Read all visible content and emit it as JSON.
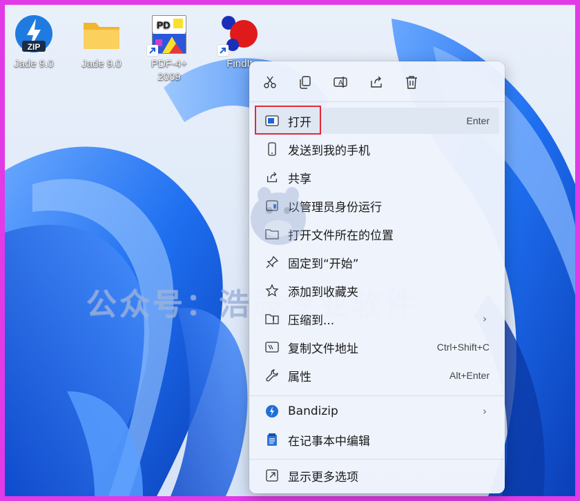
{
  "desktop": {
    "icons": [
      {
        "label": "Jade 9.0",
        "icon": "zip-archive-icon"
      },
      {
        "label": "Jade 9.0",
        "icon": "folder-icon"
      },
      {
        "label": "PDF-4+\n2009",
        "icon": "pdf-app-icon"
      },
      {
        "label": "FindIt",
        "icon": "findit-app-icon"
      }
    ],
    "watermark": "公众号：浩辰专业软件"
  },
  "context_menu": {
    "toolbar": [
      {
        "name": "cut",
        "icon": "scissors-icon"
      },
      {
        "name": "copy",
        "icon": "copy-icon"
      },
      {
        "name": "rename",
        "icon": "rename-icon"
      },
      {
        "name": "share",
        "icon": "share-icon"
      },
      {
        "name": "delete",
        "icon": "trash-icon"
      }
    ],
    "items": [
      {
        "label": "打开",
        "shortcut": "Enter",
        "icon": "open-window-icon"
      },
      {
        "label": "发送到我的手机",
        "shortcut": "",
        "icon": "phone-icon"
      },
      {
        "label": "共享",
        "shortcut": "",
        "icon": "share-icon"
      },
      {
        "label": "以管理员身份运行",
        "shortcut": "",
        "icon": "shield-icon"
      },
      {
        "label": "打开文件所在的位置",
        "shortcut": "",
        "icon": "folder-icon"
      },
      {
        "label": "固定到“开始”",
        "shortcut": "",
        "icon": "pin-icon"
      },
      {
        "label": "添加到收藏夹",
        "shortcut": "",
        "icon": "star-icon"
      },
      {
        "label": "压缩到...",
        "shortcut": "",
        "icon": "zip-icon"
      },
      {
        "label": "复制文件地址",
        "shortcut": "Ctrl+Shift+C",
        "icon": "copy-path-icon"
      },
      {
        "label": "属性",
        "shortcut": "Alt+Enter",
        "icon": "wrench-icon"
      },
      {
        "label": "Bandizip",
        "shortcut": "",
        "icon": "bandizip-icon"
      },
      {
        "label": "在记事本中编辑",
        "shortcut": "",
        "icon": "notepad-icon"
      },
      {
        "label": "显示更多选项",
        "shortcut": "",
        "icon": "more-options-icon"
      }
    ],
    "submenu_chevron": "›"
  },
  "colors": {
    "frame": "#e23ae6",
    "highlight": "#e0293a",
    "accent": "#0a64d8"
  }
}
